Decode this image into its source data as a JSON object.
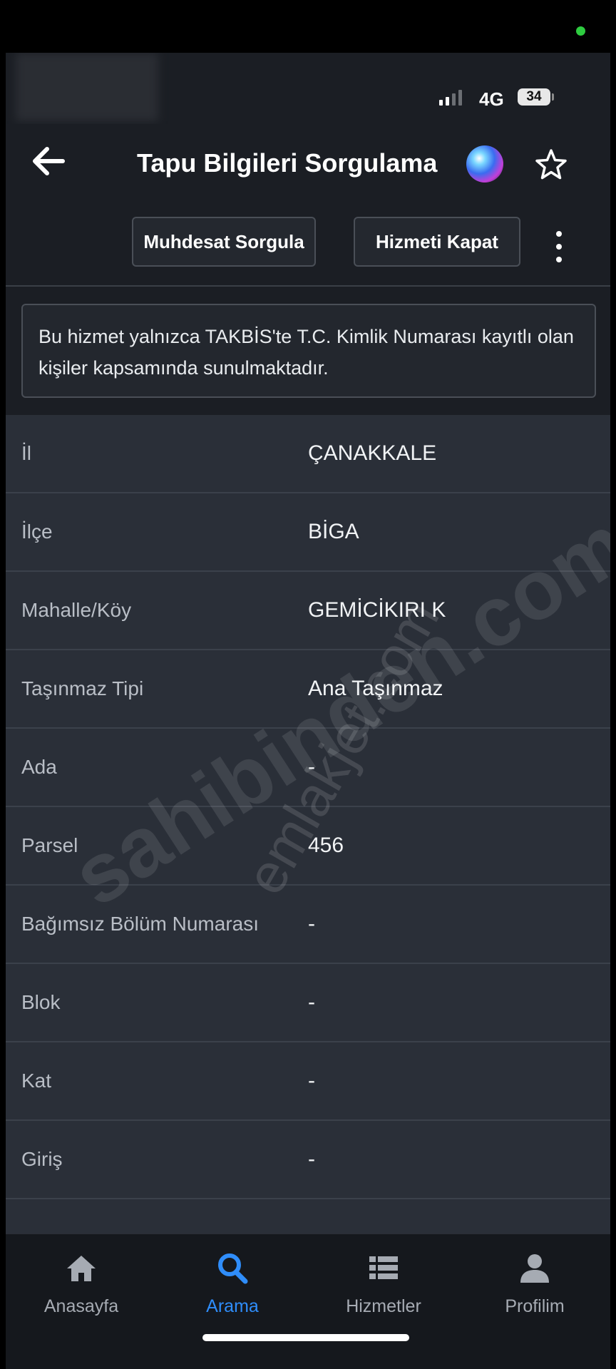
{
  "status_bar": {
    "network": "4G",
    "battery": "34"
  },
  "nav": {
    "title": "Tapu Bilgileri Sorgulama"
  },
  "actions": {
    "muhdesat": "Muhdesat Sorgula",
    "kapat": "Hizmeti Kapat"
  },
  "notice": "Bu hizmet yalnızca TAKBİS'te T.C. Kimlik Numarası kayıtlı olan kişiler kapsamında sunulmaktadır.",
  "rows": [
    {
      "label": "İl",
      "value": "ÇANAKKALE"
    },
    {
      "label": "İlçe",
      "value": "BİGA"
    },
    {
      "label": "Mahalle/Köy",
      "value": "GEMİCİKIRI K"
    },
    {
      "label": "Taşınmaz Tipi",
      "value": "Ana Taşınmaz"
    },
    {
      "label": "Ada",
      "value": "-"
    },
    {
      "label": "Parsel",
      "value": "456"
    },
    {
      "label": "Bağımsız Bölüm Numarası",
      "value": "-"
    },
    {
      "label": "Blok",
      "value": "-"
    },
    {
      "label": "Kat",
      "value": "-"
    },
    {
      "label": "Giriş",
      "value": "-"
    }
  ],
  "watermarks": [
    "sahibinden.com",
    "emlakjet.com"
  ],
  "tabs": [
    {
      "label": "Anasayfa",
      "icon": "home-icon"
    },
    {
      "label": "Arama",
      "icon": "search-icon",
      "active": true
    },
    {
      "label": "Hizmetler",
      "icon": "list-icon"
    },
    {
      "label": "Profilim",
      "icon": "person-icon"
    }
  ],
  "colors": {
    "accent": "#2f8dfa",
    "background": "#1b1e24",
    "row_background": "#2a2f38"
  }
}
